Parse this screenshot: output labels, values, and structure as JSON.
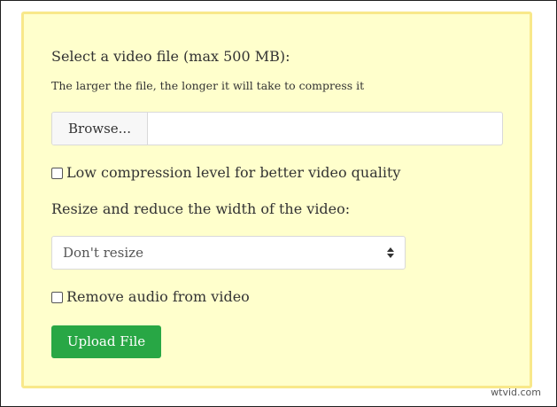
{
  "form": {
    "file_label": "Select a video file (max 500 MB):",
    "file_hint": "The larger the file, the longer it will take to compress it",
    "browse_label": "Browse...",
    "file_name": "",
    "low_compression_label": "Low compression level for better video quality",
    "low_compression_checked": false,
    "resize_label": "Resize and reduce the width of the video:",
    "resize_selected": "Don't resize",
    "remove_audio_label": "Remove audio from video",
    "remove_audio_checked": false,
    "upload_label": "Upload File"
  },
  "watermark": "wtvid.com",
  "colors": {
    "panel_bg": "#ffffcc",
    "panel_border": "#f8e88a",
    "upload_button": "#28a745"
  },
  "icons": {
    "select_arrow": "sort-arrows-icon"
  }
}
